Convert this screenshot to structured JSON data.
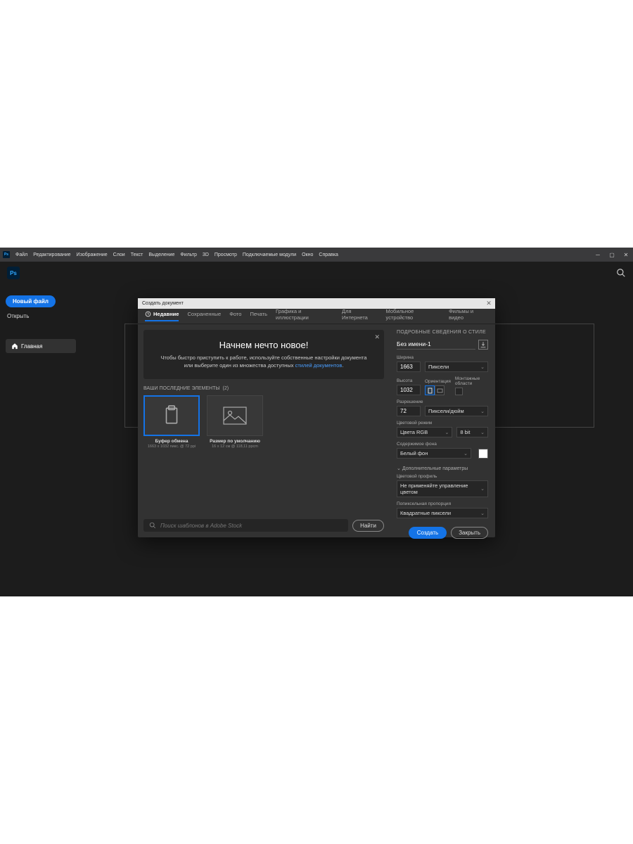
{
  "menu": {
    "items": [
      "Файл",
      "Редактирование",
      "Изображение",
      "Слои",
      "Текст",
      "Выделение",
      "Фильтр",
      "3D",
      "Просмотр",
      "Подключаемые модули",
      "Окно",
      "Справка"
    ]
  },
  "sidebar": {
    "new_file": "Новый файл",
    "open": "Открыть",
    "home": "Главная"
  },
  "dialog": {
    "title": "Создать документ",
    "tabs": [
      "Недавние",
      "Сохраненные",
      "Фото",
      "Печать",
      "Графика и иллюстрации",
      "Для Интернета",
      "Мобильное устройство",
      "Фильмы и видео"
    ],
    "banner": {
      "title": "Начнем нечто новое!",
      "text_a": "Чтобы быстро приступить к работе, используйте собственные настройки документа или выберите один из множества доступных ",
      "link": "стилей документов",
      "text_b": "."
    },
    "recent_label": "ВАШИ ПОСЛЕДНИЕ ЭЛЕМЕНТЫ",
    "recent_count": "(2)",
    "presets": [
      {
        "title": "Буфер обмена",
        "sub": "1663 x 1032 пикс. @ 72 ppi"
      },
      {
        "title": "Размер по умолчанию",
        "sub": "16 x 12 см @ 118,11 ppcm"
      }
    ],
    "search": {
      "placeholder": "Поиск шаблонов в Adobe Stock",
      "find": "Найти"
    }
  },
  "details": {
    "title": "ПОДРОБНЫЕ СВЕДЕНИЯ О СТИЛЕ",
    "name": "Без имени-1",
    "width_label": "Ширина",
    "width": "1663",
    "width_units": "Пиксели",
    "height_label": "Высота",
    "height": "1032",
    "orientation_label": "Ориентация",
    "artboards_label": "Монтажные области",
    "resolution_label": "Разрешение",
    "resolution": "72",
    "resolution_units": "Пиксели/дюйм",
    "color_mode_label": "Цветовой режим",
    "color_mode": "Цвета RGB",
    "bit_depth": "8 bit",
    "bg_label": "Содержимое фона",
    "bg": "Белый фон",
    "advanced": "Дополнительные параметры",
    "color_profile_label": "Цветовой профиль",
    "color_profile": "Не применяйте управление цветом",
    "pixel_ratio_label": "Попиксельная пропорция",
    "pixel_ratio": "Квадратные пиксели",
    "create": "Создать",
    "close": "Закрыть"
  }
}
